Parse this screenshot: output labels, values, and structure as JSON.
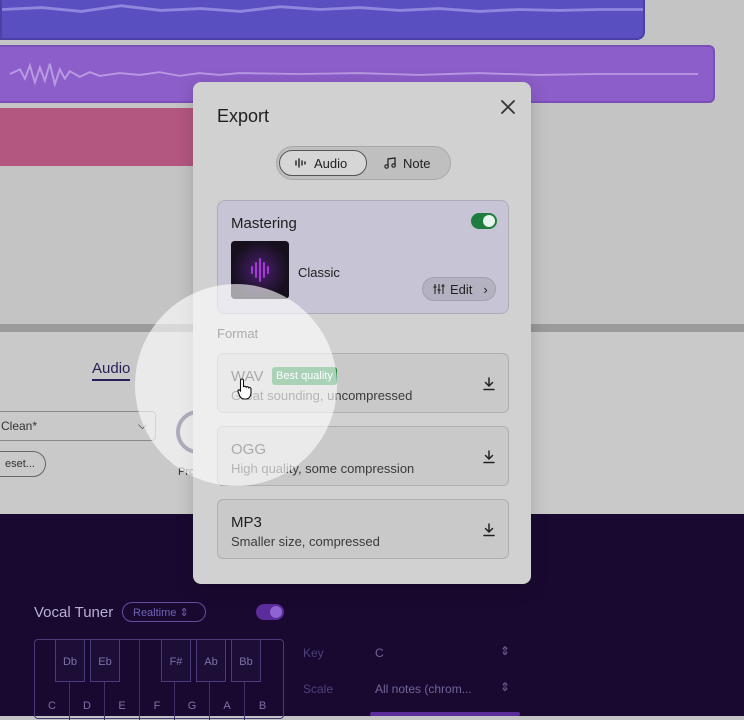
{
  "background": {
    "audio_tab": "Audio",
    "preset_select": "Clean*",
    "preset_button": "eset...",
    "knob_label": "Pro",
    "vocal_tuner": {
      "title": "Vocal Tuner",
      "mode": "Realtime",
      "piano_white_keys": [
        "C",
        "D",
        "E",
        "F",
        "G",
        "A",
        "B"
      ],
      "piano_black_keys": [
        "Db",
        "Eb",
        "F#",
        "Ab",
        "Bb"
      ],
      "key_label": "Key",
      "key_value": "C",
      "scale_label": "Scale",
      "scale_value": "All notes (chrom..."
    }
  },
  "modal": {
    "title": "Export",
    "tabs": [
      {
        "label": "Audio",
        "icon": "waveform-icon",
        "active": true
      },
      {
        "label": "Note",
        "icon": "music-note-icon",
        "active": false
      }
    ],
    "mastering": {
      "title": "Mastering",
      "enabled": true,
      "preset": "Classic",
      "edit_label": "Edit"
    },
    "format_label": "Format",
    "formats": [
      {
        "name": "WAV",
        "badge": "Best quality",
        "description": "Great sounding, uncompressed"
      },
      {
        "name": "OGG",
        "description": "High quality, some compression"
      },
      {
        "name": "MP3",
        "description": "Smaller size, compressed"
      }
    ]
  },
  "colors": {
    "toggle_on": "#1e7d3e",
    "badge": "#1f8a3f",
    "dark_panel": "#190930"
  }
}
